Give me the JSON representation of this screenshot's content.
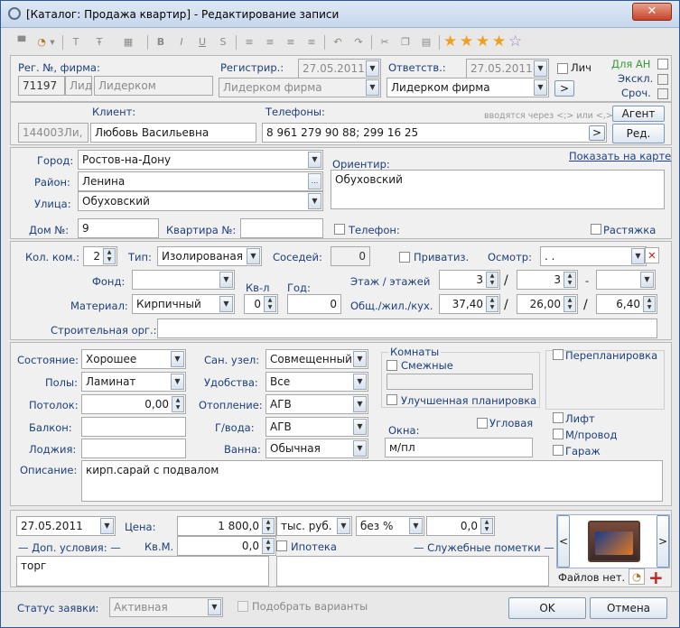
{
  "window": {
    "title": "[Каталог: Продажа квартир] - Редактирование записи",
    "close": "✕"
  },
  "toolbar": {
    "icons": [
      "printer-icon",
      "palette-icon",
      "text-icon",
      "text-size-icon",
      "color-icon",
      "bold-icon",
      "italic-icon",
      "underline-icon",
      "strike-icon",
      "align-left-icon",
      "align-center-icon",
      "align-right-icon",
      "justify-icon",
      "undo-icon",
      "redo-icon",
      "cut-icon",
      "copy-icon",
      "paste-icon"
    ],
    "rating_stars": 4,
    "rating_max": 5
  },
  "top": {
    "reg_label": "Рег. №, фирма:",
    "reg_no": "71197",
    "reg_lid": "Лид",
    "reg_firm": "Лидерком",
    "registr_label": "Регистрир.:",
    "registr_date": "27.05.2011",
    "registr_firm": "Лидерком фирма",
    "resp_label": "Ответств.:",
    "resp_date": "27.05.2011",
    "resp_firm": "Лидерком фирма",
    "lich": "Лич",
    "for_an": "Для АН",
    "excl": "Экскл.",
    "urgent": "Сроч.",
    "go_btn": ">"
  },
  "client": {
    "label": "Клиент:",
    "code": "144003Ли,",
    "name": "Любовь Васильевна",
    "phones_label": "Телефоны:",
    "hint": "вводятся через <;> или <,>",
    "phones": "8 961 279 90 88; 299 16 25",
    "agent_btn": "Агент",
    "edit_btn": "Ред.",
    "go_btn": ">"
  },
  "address": {
    "city_label": "Город:",
    "city": "Ростов-на-Дону",
    "district_label": "Район:",
    "district": "Ленина",
    "street_label": "Улица:",
    "street": "Обуховский",
    "landmark_label": "Ориентир:",
    "landmark": "Обуховский",
    "map_link": "Показать на карте",
    "house_label": "Дом №:",
    "house": "9",
    "flat_label": "Квартира №:",
    "flat": "",
    "phone_chk": "Телефон:",
    "rastyazhka": "Растяжка",
    "more_btn": "..."
  },
  "apartment": {
    "rooms_label": "Кол. ком.:",
    "rooms": "2",
    "type_label": "Тип:",
    "type": "Изолированая",
    "neighbors_label": "Соседей:",
    "neighbors": "0",
    "privat": "Приватиз.",
    "inspect_label": "Осмотр:",
    "inspect": ". .",
    "fund_label": "Фонд:",
    "fund": "",
    "kvl_label": "Кв-л",
    "year_label": "Год:",
    "floor_label": "Этаж / этажей",
    "floor": "3",
    "floors": "3",
    "dash": "-",
    "material_label": "Материал:",
    "material": "Кирпичный",
    "kvl": "0",
    "year": "0",
    "area_label": "Общ./жил./кух.",
    "area_total": "37,40",
    "area_living": "26,00",
    "area_kitchen": "6,40",
    "org_label": "Строительная орг.:",
    "org": ""
  },
  "condition": {
    "state_label": "Состояние:",
    "state": "Хорошее",
    "floor_label": "Полы:",
    "floors": "Ламинат",
    "ceiling_label": "Потолок:",
    "ceiling": "0,00",
    "balcony_label": "Балкон:",
    "balcony": "",
    "loggia_label": "Лоджия:",
    "loggia": "",
    "san_label": "Сан. узел:",
    "san": "Совмещенный",
    "amen_label": "Удобства:",
    "amen": "Все",
    "heat_label": "Отопление:",
    "heat": "АГВ",
    "water_label": "Г/вода:",
    "water": "АГВ",
    "bath_label": "Ванна:",
    "bath": "Обычная",
    "rooms_group": "Комнаты",
    "adjacent": "Смежные",
    "improved": "Улучшенная планировка",
    "corner": "Угловая",
    "windows_label": "Окна:",
    "windows": "м/пл",
    "replan": "Перепланировка",
    "lift": "Лифт",
    "mprovod": "М/провод",
    "garage": "Гараж",
    "desc_label": "Описание:",
    "desc": "кирп.сарай с подвалом"
  },
  "price": {
    "date": "27.05.2011",
    "price_label": "Цена:",
    "price": "1 800,0",
    "currency": "тыс. руб.",
    "percent": "без %",
    "percent_val": "0,0",
    "sqm_label": "Кв.М.",
    "sqm": "0,0",
    "extra_label": "Доп. условия:",
    "extra": "торг",
    "mortgage": "Ипотека",
    "service_label": "Служебные пометки",
    "service": "",
    "files_label": "Файлов нет.",
    "prev": "<",
    "next": ">"
  },
  "footer": {
    "status_label": "Статус заявки:",
    "status": "Активная",
    "match": "Подобрать варианты",
    "ok": "OK",
    "cancel": "Отмена"
  }
}
